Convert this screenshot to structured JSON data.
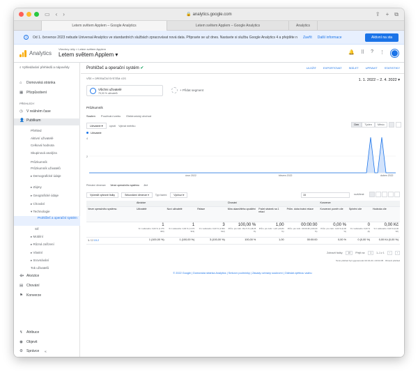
{
  "browser": {
    "url": "analytics.google.com",
    "tabs": [
      "Letem světem Applem – Google Analytics",
      "Letem světem Applem – Google Analytics",
      "Analytics"
    ]
  },
  "banner": {
    "text": "Od 1. července 2023 nebude Universal Analytics ve standardních službách zpracovávat nová data. Připravte se už dnes. Nastavte si službu Google Analytics 4 a přejděte na ni",
    "link1": "Zavřít",
    "link2": "Další informace",
    "button": "Aktivní na sta"
  },
  "header": {
    "product": "Analytics",
    "breadcrumb": "Všechny účty > Letem světem Applem",
    "property": "Letem světem Applem"
  },
  "sidebar": {
    "search": "Vyhledávání přehledů a nápovědy",
    "items": {
      "home": "Domovská stránka",
      "custom": "Přizpůsobení",
      "reports_section": "PŘEHLEDY",
      "realtime": "V reálném čase",
      "audience": "Publikum",
      "overview": "Přehled",
      "active_users": "Aktivní uživatelé",
      "lifetime_value": "Celková hodnota",
      "cohort": "Skupinová analýza",
      "explorer": "Průzkumník",
      "audience2": "Průzkumník uživatelů",
      "demographics": "Demografické údaje",
      "interests": "Zájmy",
      "geo": "Geografické údaje",
      "behavior": "Chování",
      "technology": "Technologie",
      "browser_os": "Prohlížeč a operační systém",
      "network": "Síť",
      "mobile": "Mobilní",
      "cross_device": "Různá zařízení",
      "custom2": "Vlastní",
      "benchmark": "Srovnávání",
      "users_flow": "Tok uživatelů",
      "acquisition": "Akvizice",
      "behavior2": "Chování",
      "conversions": "Konverze",
      "attribution": "Atribuce",
      "discover": "Objevit",
      "admin": "Správce"
    }
  },
  "report": {
    "title": "Prohlížeč a operační systém",
    "actions": [
      "ULOŽIT",
      "EXPORTOVAT",
      "SDÍLET",
      "UPRAVIT",
      "STATISTIKY"
    ],
    "crumb": "VŠE » OPERAČNÍ SYSTÉM: iOS",
    "date_range": "1. 1. 2022 – 2. 4. 2022",
    "segment1": "Všichni uživatelé",
    "segment1_sub": "75,00 % uživatelů",
    "segment2": "+ Přidat segment",
    "explorer_head": "Průzkumník",
    "subtabs": [
      "Souhrn",
      "Používání webu",
      "Elektronický obchod"
    ],
    "metric_select": "Uživatelé",
    "vs": "oproti",
    "select_metric": "Vybrat metriku",
    "period_buttons": [
      "Den",
      "Týden",
      "Měsíc"
    ],
    "legend": "Uživatelé",
    "y_ticks": [
      "4",
      "2"
    ],
    "x_labels": [
      "únor 2022",
      "březen 2022",
      "duben 2022"
    ],
    "primary_dim_label": "Primární dimenze:",
    "primary_dim": "Verze operačního systému",
    "other": "Jiné",
    "plot_rows": "Vykreslit vybrané řádky",
    "secondary_dim": "Sekundární dimenze",
    "sort_type": "Typ řazení:",
    "default": "Výchozí",
    "search_value": "15",
    "advanced": "rozšířené",
    "table": {
      "group_acq": "Akvizice",
      "group_beh": "Chování",
      "group_conv": "Konverze",
      "dim_header": "Verze operačního systému",
      "headers": [
        "Uživatelé",
        "Noví uživatelé",
        "Relace",
        "Míra okamžitého opuštění",
        "Počet stránek na 1 relaci",
        "Prům. doba trvání relace",
        "Konverzní poměr cíle",
        "Splnění cíle",
        "Hodnota cíle"
      ],
      "totals": [
        "1",
        "1",
        "3",
        "100,00 %",
        "1,00",
        "00:00:00",
        "0,00 %",
        "0",
        "0,00 Kč"
      ],
      "totals_sub": [
        "% z celkového: 0,00 % (1 276 463)",
        "% z celkového: 0,00 % (1 273 521)",
        "% z celkového: 0,00 % (1 964 612)",
        "Prům. pro zobr.: 84,71 % (18,05 %)",
        "Prům. pro zobr.: 1,26 (-20,84 %)",
        "Prům. pro zobr.: 00:00:48 (-100,00 %)",
        "Prům. pro zobr.: 0,00 % (0,00 %)",
        "% z celkového: 0,00 % (0)",
        "% z celkového: 0,00 % (0,00 Kč)"
      ],
      "rows": [
        {
          "idx": "1.",
          "name": "15.2",
          "values": [
            "1 (100,00 %)",
            "1 (100,00 %)",
            "3 (100,00 %)",
            "100,00 %",
            "1,00",
            "00:00:00",
            "0,00 %",
            "0 (0,00 %)",
            "0,00 Kč (0,00 %)"
          ]
        }
      ]
    },
    "pager": {
      "show_rows": "Zobrazit řádky:",
      "rows": "10",
      "goto": "Přejít na:",
      "page": "1",
      "range": "1–1 z 1"
    },
    "gen_note": "Tento přehled byl vygenerován 02.04.22 v 20:04:35 · Obnovit přehled"
  },
  "footer": "© 2022 Google | Domovská stránka Analytics | Smluvní podmínky | Zásady ochrany soukromí | Odeslat zpětnou vazbu"
}
